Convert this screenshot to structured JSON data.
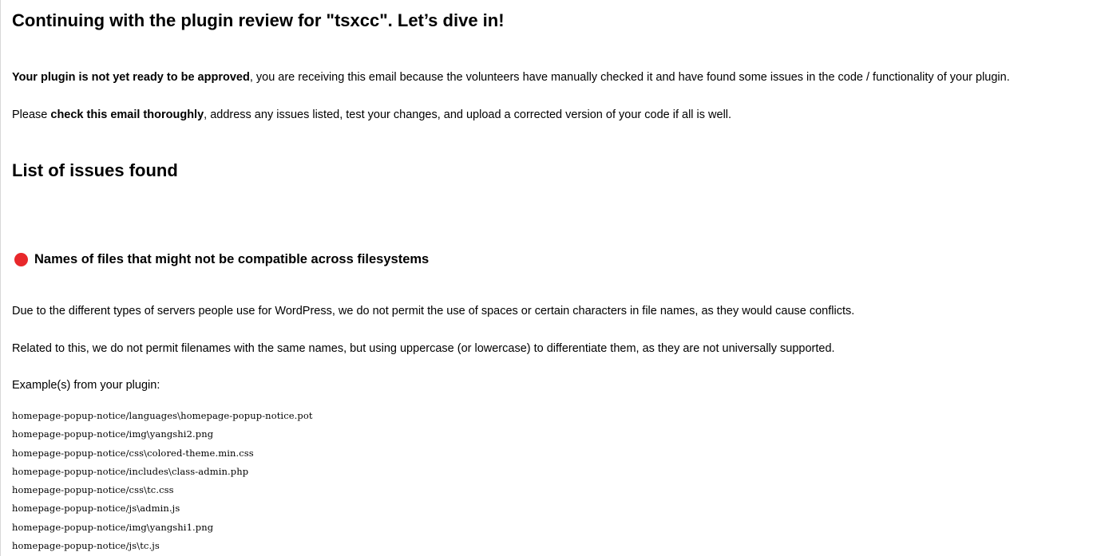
{
  "email": {
    "title": "Continuing with the plugin review for \"tsxcc\". Let’s dive in!",
    "intro": {
      "bold_1": "Your plugin is not yet ready to be approved",
      "text_1": ", you are receiving this email because the volunteers have manually checked it and have found some issues in the code / functionality of your plugin."
    },
    "check": {
      "prefix": "Please ",
      "bold": "check this email thoroughly",
      "suffix": ", address any issues listed, test your changes, and upload a corrected version of your code if all is well."
    },
    "issues_heading": "List of issues found",
    "issue": {
      "title": "Names of files that might not be compatible across filesystems",
      "indicator_color": "#e8282b",
      "description_1": "Due to the different types of servers people use for WordPress, we do not permit the use of spaces or certain characters in file names, as they would cause conflicts.",
      "description_2": "Related to this, we do not permit filenames with the same names, but using uppercase (or lowercase) to differentiate them, as they are not universally supported.",
      "examples_label": "Example(s) from your plugin:",
      "examples": [
        "homepage-popup-notice/languages\\homepage-popup-notice.pot",
        "homepage-popup-notice/img\\yangshi2.png",
        "homepage-popup-notice/css\\colored-theme.min.css",
        "homepage-popup-notice/includes\\class-admin.php",
        "homepage-popup-notice/css\\tc.css",
        "homepage-popup-notice/js\\admin.js",
        "homepage-popup-notice/img\\yangshi1.png",
        "homepage-popup-notice/js\\tc.js"
      ]
    }
  }
}
